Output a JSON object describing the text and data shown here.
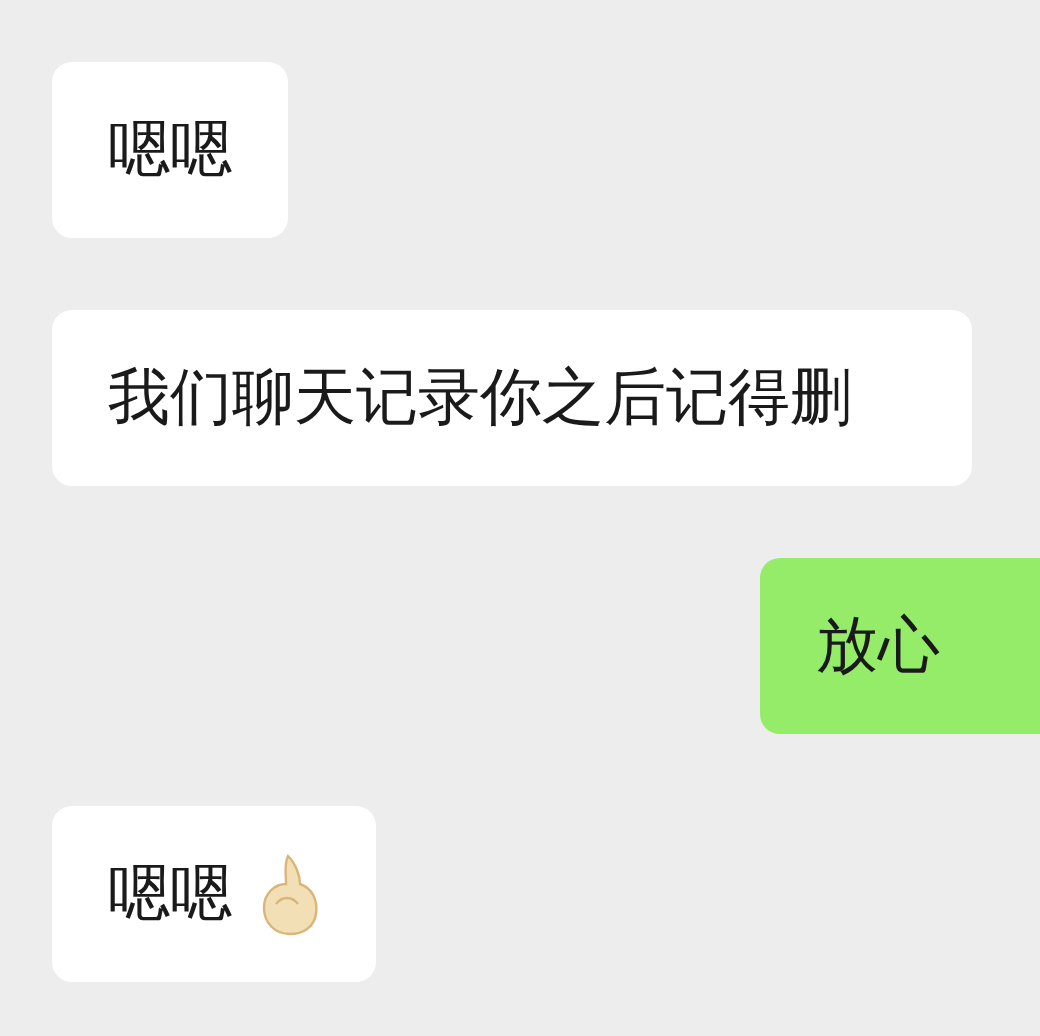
{
  "messages": [
    {
      "kind": "received",
      "text": "嗯嗯",
      "emoji": false
    },
    {
      "kind": "received",
      "text": "我们聊天记录你之后记得删",
      "emoji": false
    },
    {
      "kind": "sent",
      "text": "放心",
      "emoji": false
    },
    {
      "kind": "received",
      "text": "嗯嗯",
      "emoji": true
    }
  ]
}
